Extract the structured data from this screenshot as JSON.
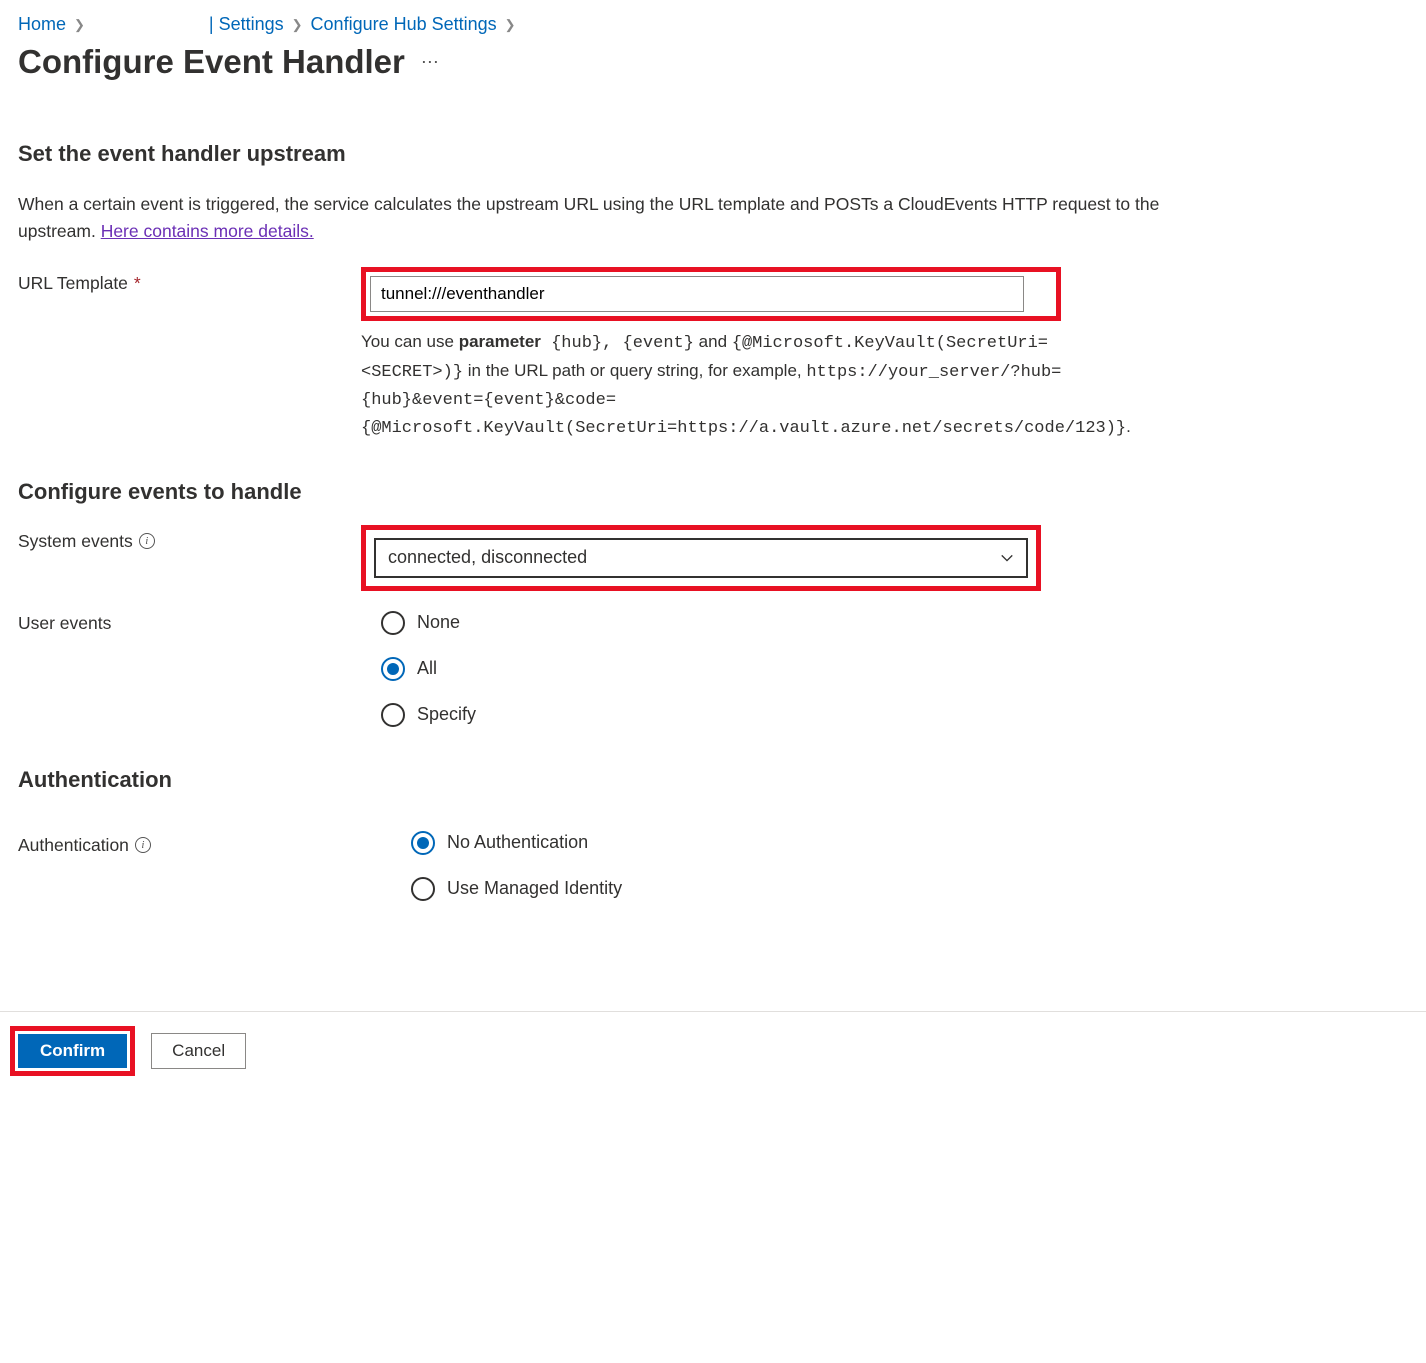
{
  "breadcrumb": {
    "home": "Home",
    "settings": "| Settings",
    "configure_hub": "Configure Hub Settings"
  },
  "page_title": "Configure Event Handler",
  "section1": {
    "heading": "Set the event handler upstream",
    "desc_prefix": "When a certain event is triggered, the service calculates the upstream URL using the URL template and POSTs a CloudEvents HTTP request to the upstream. ",
    "desc_link": "Here contains more details.",
    "url_template_label": "URL Template",
    "url_template_value": "tunnel:///eventhandler",
    "helper_pre": "You can use ",
    "helper_bold": "parameter",
    "helper_mono1": " {hub}, {event}",
    "helper_mid": " and ",
    "helper_mono2": "{@Microsoft.KeyVault(SecretUri=<SECRET>)}",
    "helper_post1": " in the URL path or query string, for example, ",
    "helper_mono3": "https://your_server/?hub={hub}&event={event}&code={@Microsoft.KeyVault(SecretUri=https://a.vault.azure.net/secrets/code/123)}",
    "helper_post2": "."
  },
  "section2": {
    "heading": "Configure events to handle",
    "system_events_label": "System events",
    "system_events_value": "connected, disconnected",
    "user_events_label": "User events",
    "user_events_options": {
      "none": "None",
      "all": "All",
      "specify": "Specify"
    },
    "user_events_selected": "all"
  },
  "section3": {
    "heading": "Authentication",
    "auth_label": "Authentication",
    "auth_options": {
      "none": "No Authentication",
      "managed": "Use Managed Identity"
    },
    "auth_selected": "none"
  },
  "footer": {
    "confirm": "Confirm",
    "cancel": "Cancel"
  }
}
